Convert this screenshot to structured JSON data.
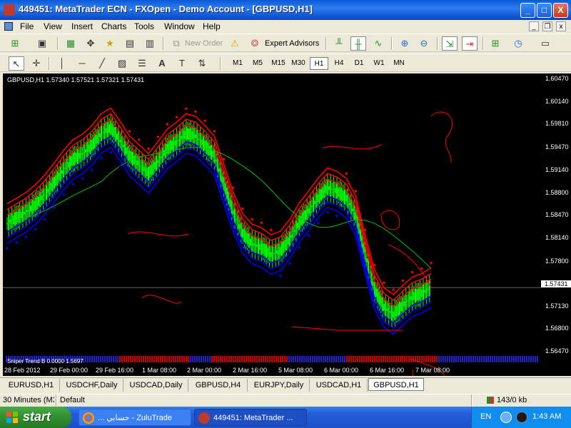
{
  "window": {
    "title": "449451: MetaTrader ECN - FXOpen - Demo Account - [GBPUSD,H1]",
    "controls": [
      "_",
      "□",
      "X"
    ],
    "mdi_controls": [
      "_",
      "❐",
      "x"
    ]
  },
  "menu": {
    "items": [
      "File",
      "View",
      "Insert",
      "Charts",
      "Tools",
      "Window",
      "Help"
    ]
  },
  "toolbar": {
    "new_order_label": "New Order",
    "expert_advisors_label": "Expert Advisors",
    "timeframes": [
      "M1",
      "M5",
      "M15",
      "M30",
      "H1",
      "H4",
      "D1",
      "W1",
      "MN"
    ],
    "active_timeframe": "H1"
  },
  "chart": {
    "symbol_header": "GBPUSD,H1  1.57340 1.57521 1.57321 1.57431",
    "indicator_label": "Sniper Trend B 0.0000 1.5697",
    "current_price": "1.57431",
    "price_ticks": [
      "1.60470",
      "1.60140",
      "1.59810",
      "1.59470",
      "1.59140",
      "1.58800",
      "1.58470",
      "1.58140",
      "1.57800",
      "1.57130",
      "1.56800",
      "1.56470"
    ],
    "time_ticks": [
      "28 Feb 2012",
      "29 Feb 00:00",
      "29 Feb 16:00",
      "1 Mar 08:00",
      "2 Mar 00:00",
      "2 Mar 16:00",
      "5 Mar 08:00",
      "6 Mar 00:00",
      "6 Mar 16:00",
      "7 Mar 08:00"
    ],
    "colors": {
      "bull": "#00ff00",
      "bear": "#00ff00",
      "upper_band": "#ff0000",
      "lower_band": "#0000ff",
      "ma": "#00c000",
      "annotation": "#ff0000"
    }
  },
  "chart_data": {
    "type": "line",
    "series": [
      {
        "values": [
          1.5834,
          1.5842,
          1.585,
          1.5861,
          1.5875,
          1.5892,
          1.591,
          1.5925,
          1.5933,
          1.5945,
          1.5962,
          1.597,
          1.5951,
          1.593,
          1.5918,
          1.5905,
          1.5922,
          1.594,
          1.595,
          1.5962,
          1.5958,
          1.5945,
          1.593,
          1.589,
          1.585,
          1.582,
          1.5805,
          1.58,
          1.579,
          1.5795,
          1.5812,
          1.5835,
          1.5852,
          1.587,
          1.5885,
          1.588,
          1.587,
          1.5845,
          1.579,
          1.574,
          1.5715,
          1.5705,
          1.5718,
          1.573,
          1.5735,
          1.5743
        ]
      }
    ],
    "ylim": [
      1.5647,
      1.6047
    ]
  },
  "tabs": {
    "items": [
      "EURUSD,H1",
      "USDCHF,Daily",
      "USDCAD,Daily",
      "GBPUSD,H4",
      "EURJPY,Daily",
      "USDCAD,H1",
      "GBPUSD,H1"
    ],
    "active": "GBPUSD,H1"
  },
  "status": {
    "left": "30 Minutes (M3",
    "profile": "Default",
    "traffic": "143/0 kb"
  },
  "taskbar": {
    "start_label": "start",
    "tasks": [
      "... حسابي - ZuluTrade",
      "449451: MetaTrader ..."
    ],
    "lang": "EN",
    "time": "1:43 AM"
  }
}
